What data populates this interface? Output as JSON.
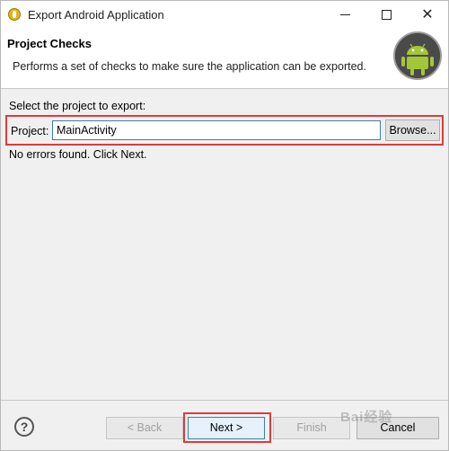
{
  "window": {
    "title": "Export Android Application"
  },
  "header": {
    "title": "Project Checks",
    "description": "Performs a set of checks to make sure the application can be exported."
  },
  "main": {
    "select_label": "Select the project to export:",
    "project_label": "Project:",
    "project_value": "MainActivity",
    "browse_label": "Browse...",
    "status": "No errors found. Click Next."
  },
  "footer": {
    "help_icon": "?",
    "back_label": "< Back",
    "next_label": "Next >",
    "finish_label": "Finish",
    "cancel_label": "Cancel",
    "watermark": "Bai经验"
  },
  "colors": {
    "highlight": "#e03a3a",
    "focus": "#3c7fb1",
    "android_green": "#a4c639"
  }
}
